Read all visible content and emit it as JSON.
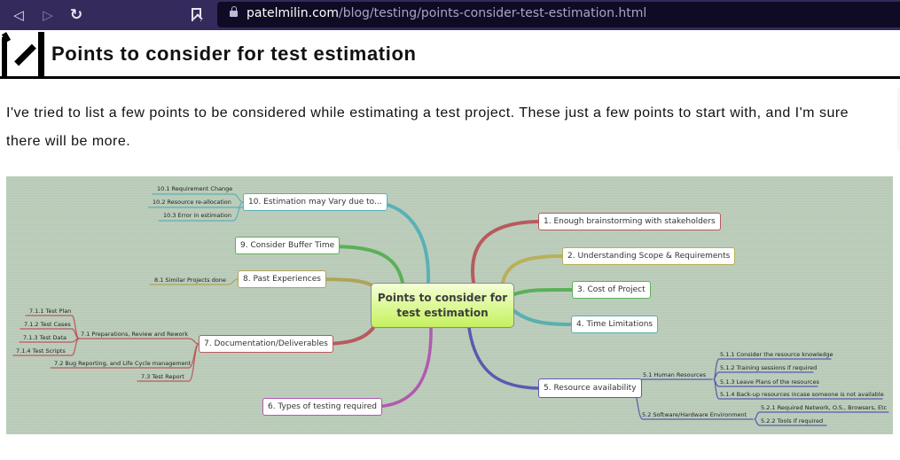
{
  "browser": {
    "back_icon": "back-arrow-icon",
    "forward_icon": "forward-arrow-icon",
    "reload_icon": "reload-icon",
    "bookmark_icon": "bookmark-icon",
    "lock_icon": "lock-icon",
    "url_host": "patelmilin.com",
    "url_path": "/blog/testing/points-consider-test-estimation.html"
  },
  "page": {
    "title": "Points to consider for test estimation",
    "intro": "I've tried to list a few points to be considered while estimating a test project. These just a few points to start with, and I'm sure there will be more."
  },
  "mindmap": {
    "central": "Points to consider for test estimation",
    "colors": {
      "branch1": "#b85a5e",
      "branch2": "#b8b05a",
      "branch3": "#5bb057",
      "branch4": "#5ab0b0",
      "branch5": "#5a5ab0",
      "branch6": "#b05ab0",
      "branch7": "#b85a5e",
      "branch8": "#b0a45a",
      "branch9": "#5bb057",
      "branch10": "#5ab0b8"
    },
    "branches": [
      {
        "id": "1",
        "label": "1. Enough brainstorming with stakeholders"
      },
      {
        "id": "2",
        "label": "2. Understanding Scope & Requirements"
      },
      {
        "id": "3",
        "label": "3. Cost of Project"
      },
      {
        "id": "4",
        "label": "4. Time Limitations"
      },
      {
        "id": "5",
        "label": "5. Resource availability",
        "children": [
          {
            "label": "5.1 Human Resources",
            "children": [
              "5.1.1  Consider the resource knowledge",
              "5.1.2  Training sessions if required",
              "5.1.3  Leave Plans of the resources",
              "5.1.4  Back-up resources incase someone is not available"
            ]
          },
          {
            "label": "5.2  Software/Hardware Environment",
            "children": [
              "5.2.1  Required Network, O.S., Browsers, Etc",
              "5.2.2  Tools if required"
            ]
          }
        ]
      },
      {
        "id": "6",
        "label": "6. Types of testing required"
      },
      {
        "id": "7",
        "label": "7. Documentation/Deliverables",
        "children": [
          {
            "label": "7.1  Preparations, Review and Rework",
            "children": [
              "7.1.1  Test Plan",
              "7.1.2  Test Cases",
              "7.1.3  Test Data",
              "7.1.4  Test Scripts"
            ]
          },
          {
            "label": "7.2  Bug Reporting, and Life Cycle management"
          },
          {
            "label": "7.3  Test Report"
          }
        ]
      },
      {
        "id": "8",
        "label": "8. Past Experiences",
        "children": [
          {
            "label": "8.1  Similar Projects done"
          }
        ]
      },
      {
        "id": "9",
        "label": "9. Consider Buffer Time"
      },
      {
        "id": "10",
        "label": "10. Estimation may Vary due to...",
        "children": [
          {
            "label": "10.1  Requirement Change"
          },
          {
            "label": "10.2  Resource re-allocation"
          },
          {
            "label": "10.3  Error in estimation"
          }
        ]
      }
    ]
  }
}
